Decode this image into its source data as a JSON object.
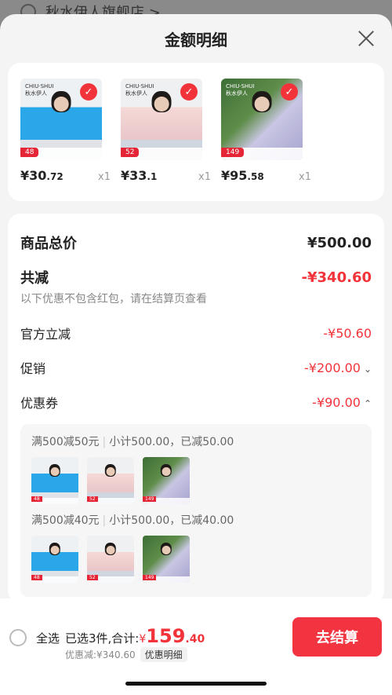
{
  "background_store": {
    "name": "秋水伊人旗舰店 >"
  },
  "sheet": {
    "title": "金额明细"
  },
  "products": [
    {
      "price_int": "¥30",
      "price_dec": ".72",
      "qty": "x1",
      "tag": "48"
    },
    {
      "price_int": "¥33",
      "price_dec": ".1",
      "qty": "x1",
      "tag": "52"
    },
    {
      "price_int": "¥95",
      "price_dec": ".58",
      "qty": "x1",
      "tag": "149"
    }
  ],
  "brand_text": "CHIU·SHUI 秋水伊人",
  "details": {
    "total_label": "商品总价",
    "total_value": "¥500.00",
    "discount_label": "共减",
    "discount_value": "-¥340.60",
    "note": "以下优惠不包含红包，请在结算页查看",
    "official_label": "官方立减",
    "official_value": "-¥50.60",
    "promo_label": "促销",
    "promo_value": "-¥200.00",
    "coupon_label": "优惠券",
    "coupon_value": "-¥90.00"
  },
  "coupons": [
    {
      "rule": "满500减50元",
      "subtotal": "小计500.00，已减50.00"
    },
    {
      "rule": "满500减40元",
      "subtotal": "小计500.00，已减40.00"
    }
  ],
  "bottom": {
    "select_all": "全选",
    "selected_text": "已选3件,合计:",
    "currency": "¥",
    "total_int": "159",
    "total_dec": ".40",
    "saved_text": "优惠减:¥340.60",
    "detail_link": "优惠明细",
    "checkout": "去结算"
  },
  "colors": {
    "accent": "#f2333a"
  }
}
